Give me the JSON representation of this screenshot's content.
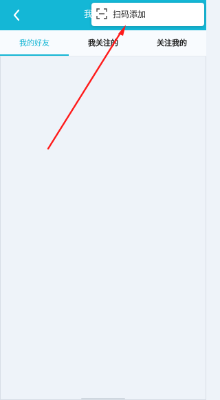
{
  "header": {
    "back_icon": "chevron-left-icon",
    "title_visible": "我",
    "background_color": "#14b7d6"
  },
  "tabs": [
    {
      "label": "我的好友",
      "selected": true
    },
    {
      "label": "我关注的",
      "selected": false
    },
    {
      "label": "关注我的",
      "selected": false
    }
  ],
  "menu": {
    "item": {
      "label": "扫码添加",
      "icon": "scan-icon"
    }
  },
  "annotation": {
    "arrow_color": "#ff1a1a"
  }
}
